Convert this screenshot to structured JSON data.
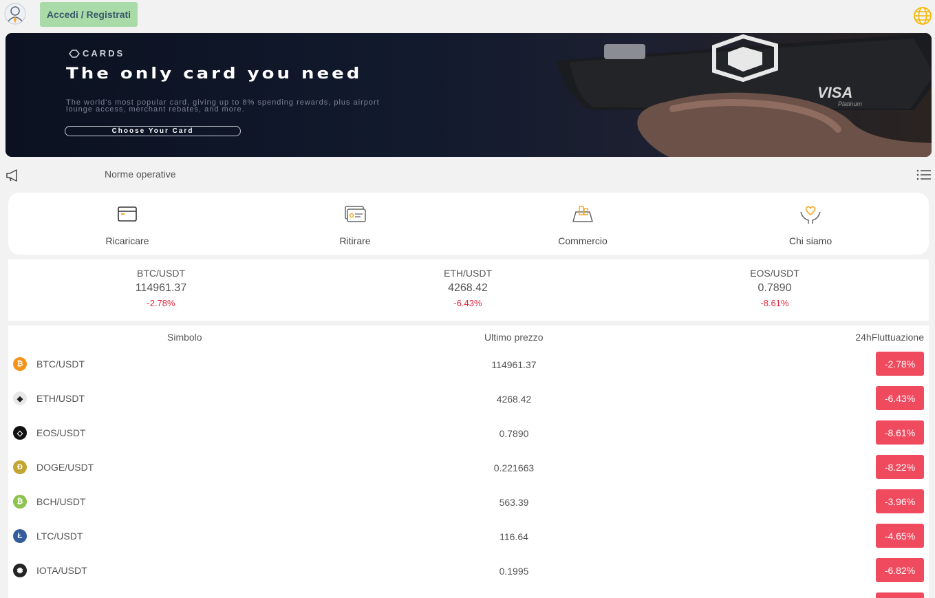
{
  "header": {
    "login_label": "Accedi / Registrati"
  },
  "banner": {
    "brand": "CARDS",
    "headline": "The only card you need",
    "subtitle": "The world's most popular card, giving up to 8% spending rewards, plus airport lounge access, merchant rebates, and more.",
    "cta": "Choose Your Card",
    "card_brand": "VISA",
    "card_tier": "Platinum"
  },
  "notice": {
    "text": "Norme operative"
  },
  "quick_actions": [
    {
      "label": "Ricaricare",
      "icon": "card-icon"
    },
    {
      "label": "Ritirare",
      "icon": "withdraw-icon"
    },
    {
      "label": "Commercio",
      "icon": "trade-icon"
    },
    {
      "label": "Chi siamo",
      "icon": "about-heart-icon"
    }
  ],
  "tickers": [
    {
      "pair": "BTC/USDT",
      "price": "114961.37",
      "change": "-2.78%"
    },
    {
      "pair": "ETH/USDT",
      "price": "4268.42",
      "change": "-6.43%"
    },
    {
      "pair": "EOS/USDT",
      "price": "0.7890",
      "change": "-8.61%"
    }
  ],
  "market": {
    "headers": {
      "symbol": "Simbolo",
      "last_price": "Ultimo prezzo",
      "change": "24hFluttuazione"
    },
    "rows": [
      {
        "symbol": "BTC/USDT",
        "price": "114961.37",
        "change": "-2.78%",
        "coin_glyph": "₿",
        "coin_color": "#f7931a"
      },
      {
        "symbol": "ETH/USDT",
        "price": "4268.42",
        "change": "-6.43%",
        "coin_glyph": "◆",
        "coin_color": "#e8e8e8"
      },
      {
        "symbol": "EOS/USDT",
        "price": "0.7890",
        "change": "-8.61%",
        "coin_glyph": "◇",
        "coin_color": "#111111"
      },
      {
        "symbol": "DOGE/USDT",
        "price": "0.221663",
        "change": "-8.22%",
        "coin_glyph": "Ð",
        "coin_color": "#c2a633"
      },
      {
        "symbol": "BCH/USDT",
        "price": "563.39",
        "change": "-3.96%",
        "coin_glyph": "₿",
        "coin_color": "#8dc351"
      },
      {
        "symbol": "LTC/USDT",
        "price": "116.64",
        "change": "-4.65%",
        "coin_glyph": "Ł",
        "coin_color": "#345d9d"
      },
      {
        "symbol": "IOTA/USDT",
        "price": "0.1995",
        "change": "-6.82%",
        "coin_glyph": "✺",
        "coin_color": "#242424"
      }
    ]
  },
  "colors": {
    "negative": "#f04a5e",
    "accent_green": "#a8dba8",
    "icon_orange": "#f5a623"
  }
}
